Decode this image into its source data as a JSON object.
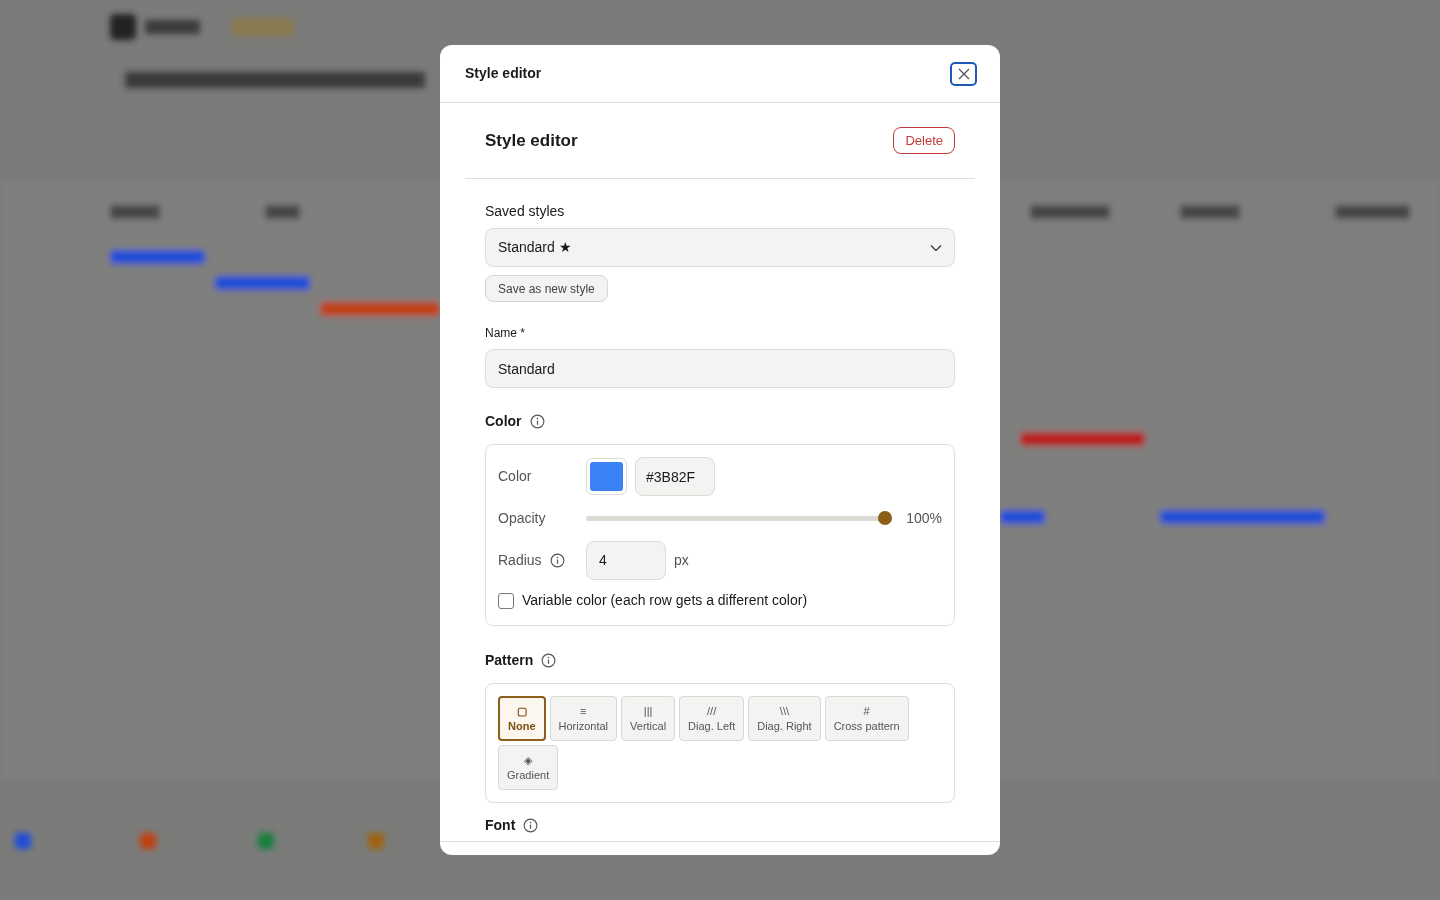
{
  "dialog": {
    "title": "Style editor",
    "heading": "Style editor",
    "delete_label": "Delete",
    "saved_styles": {
      "label": "Saved styles",
      "value": "Standard ★",
      "save_new_label": "Save as new style"
    },
    "name": {
      "label": "Name *",
      "value": "Standard"
    },
    "color_section": {
      "title": "Color",
      "color_label": "Color",
      "color": "#3b82f6",
      "hex_value": "#3B82F",
      "opacity_label": "Opacity",
      "opacity": {
        "level": 1
      },
      "opacity_reading": "100%",
      "radius_label": "Radius",
      "radius_value": "4",
      "radius_unit": "px",
      "variable_color": {
        "label": "Variable color (each row gets a different color)",
        "checked": false
      }
    },
    "pattern_section": {
      "title": "Pattern",
      "patterns": [
        {
          "symbol": "▢",
          "label": "None",
          "selected": true
        },
        {
          "symbol": "≡",
          "label": "Horizontal",
          "selected": false
        },
        {
          "symbol": "|||",
          "label": "Vertical",
          "selected": false
        },
        {
          "symbol": "///",
          "label": "Diag. Left",
          "selected": false
        },
        {
          "symbol": "\\\\\\",
          "label": "Diag. Right",
          "selected": false
        },
        {
          "symbol": "#",
          "label": "Cross pattern",
          "selected": false
        },
        {
          "symbol": "◈",
          "label": "Gradient",
          "selected": false
        }
      ]
    },
    "font_section": {
      "title": "Font"
    }
  }
}
